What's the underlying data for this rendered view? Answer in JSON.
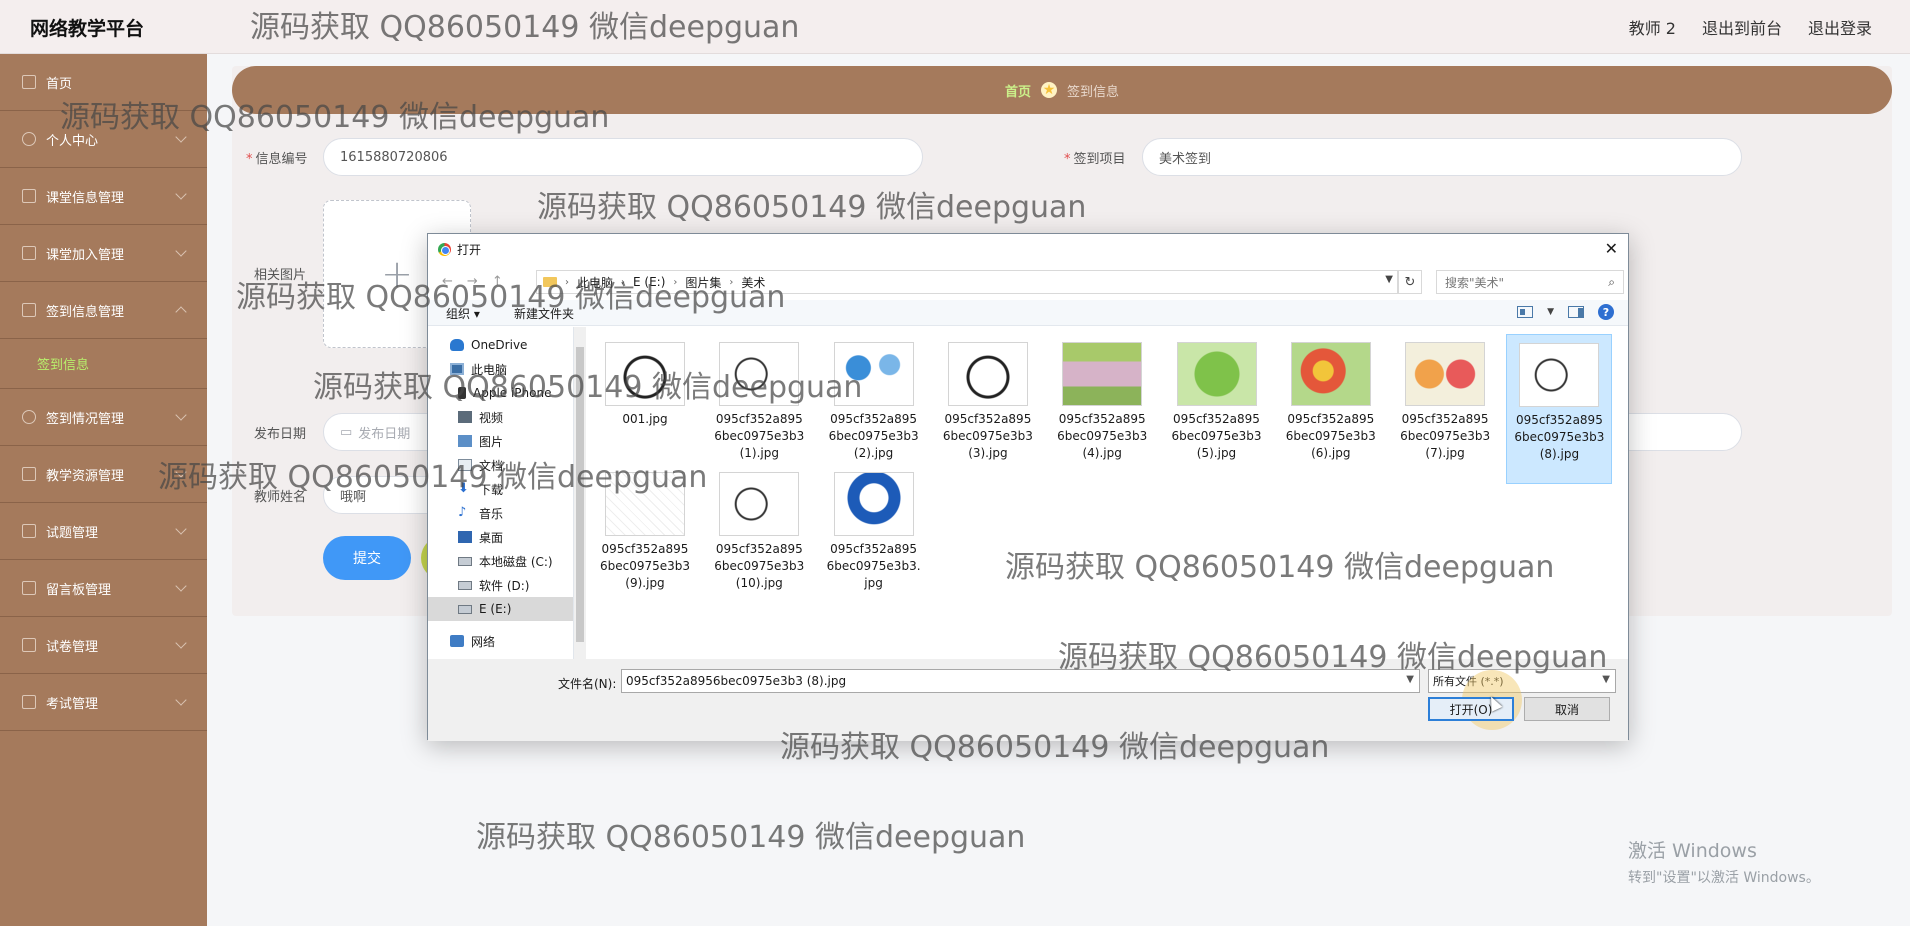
{
  "app": {
    "brand": "网络教学平台",
    "header_links": [
      "教师 2",
      "退出到前台",
      "退出登录"
    ]
  },
  "sidebar": {
    "items": [
      {
        "label": "首页",
        "icon": "home-icon",
        "expand": "none"
      },
      {
        "label": "个人中心",
        "icon": "user-icon",
        "expand": "down"
      },
      {
        "label": "课堂信息管理",
        "icon": "chat-icon",
        "expand": "down"
      },
      {
        "label": "课堂加入管理",
        "icon": "bag-icon",
        "expand": "down"
      },
      {
        "label": "签到信息管理",
        "icon": "sign-icon",
        "expand": "up"
      }
    ],
    "sub_item": "签到信息",
    "items_after": [
      {
        "label": "签到情况管理",
        "icon": "user-icon",
        "expand": "down"
      },
      {
        "label": "教学资源管理",
        "icon": "box-icon",
        "expand": "down"
      },
      {
        "label": "试题管理",
        "icon": "grid-icon",
        "expand": "down"
      },
      {
        "label": "留言板管理",
        "icon": "grid-icon",
        "expand": "down"
      },
      {
        "label": "试卷管理",
        "icon": "circle-icon",
        "expand": "down"
      },
      {
        "label": "考试管理",
        "icon": "list-icon",
        "expand": "down"
      }
    ]
  },
  "breadcrumb": {
    "home": "首页",
    "current": "签到信息"
  },
  "form": {
    "info_no_label": "信息编号",
    "info_no_value": "1615880720806",
    "project_label": "签到项目",
    "project_value": "美术签到",
    "image_label": "相关图片",
    "upload_plus": "+",
    "date_label": "发布日期",
    "date_placeholder": "发布日期",
    "teacher_label": "教师姓名",
    "teacher_value": "哦啊",
    "submit": "提交"
  },
  "activation": {
    "line1": "激活 Windows",
    "line2": "转到\"设置\"以激活 Windows。"
  },
  "dialog": {
    "title": "打开",
    "close": "✕",
    "path": [
      "此电脑",
      "E (E:)",
      "图片集",
      "美术"
    ],
    "search_placeholder": "搜索\"美术\"",
    "toolbar_organize": "组织 ▾",
    "toolbar_new_folder": "新建文件夹",
    "nav": [
      {
        "label": "OneDrive",
        "icon": "cloud-icon"
      },
      {
        "label": "此电脑",
        "icon": "computer-icon"
      },
      {
        "label": "Apple iPhone",
        "icon": "phone-icon"
      },
      {
        "label": "视频",
        "icon": "video-icon"
      },
      {
        "label": "图片",
        "icon": "picture-icon"
      },
      {
        "label": "文档",
        "icon": "document-icon"
      },
      {
        "label": "下载",
        "icon": "download-icon"
      },
      {
        "label": "音乐",
        "icon": "music-icon"
      },
      {
        "label": "桌面",
        "icon": "desktop-icon"
      },
      {
        "label": "本地磁盘 (C:)",
        "icon": "drive-icon"
      },
      {
        "label": "软件 (D:)",
        "icon": "drive-icon"
      },
      {
        "label": "E (E:)",
        "icon": "drive-icon"
      },
      {
        "label": "网络",
        "icon": "network-icon"
      }
    ],
    "files": [
      {
        "name": "001.jpg",
        "thumb": "th-bear"
      },
      {
        "name": "095cf352a8956bec0975e3b3 (1).jpg",
        "thumb": "th-mouse"
      },
      {
        "name": "095cf352a8956bec0975e3b3 (2).jpg",
        "thumb": "th-mush"
      },
      {
        "name": "095cf352a8956bec0975e3b3 (3).jpg",
        "thumb": "th-bear"
      },
      {
        "name": "095cf352a8956bec0975e3b3 (4).jpg",
        "thumb": "th-color1"
      },
      {
        "name": "095cf352a8956bec0975e3b3 (5).jpg",
        "thumb": "th-color2"
      },
      {
        "name": "095cf352a8956bec0975e3b3 (6).jpg",
        "thumb": "th-color3"
      },
      {
        "name": "095cf352a8956bec0975e3b3 (7).jpg",
        "thumb": "th-color4"
      },
      {
        "name": "095cf352a8956bec0975e3b3 (8).jpg",
        "thumb": "th-mouse",
        "selected": true
      },
      {
        "name": "095cf352a8956bec0975e3b3 (9).jpg",
        "thumb": "th-sketch"
      },
      {
        "name": "095cf352a8956bec0975e3b3 (10).jpg",
        "thumb": "th-mouse"
      },
      {
        "name": "095cf352a8956bec0975e3b3.jpg",
        "thumb": "th-dora"
      }
    ],
    "filename_label": "文件名(N):",
    "filename_value": "095cf352a8956bec0975e3b3 (8).jpg",
    "filter_value": "所有文件 (*.*)",
    "open_btn": "打开(O)",
    "cancel_btn": "取消"
  },
  "watermark": "源码获取 QQ86050149 微信deepguan"
}
